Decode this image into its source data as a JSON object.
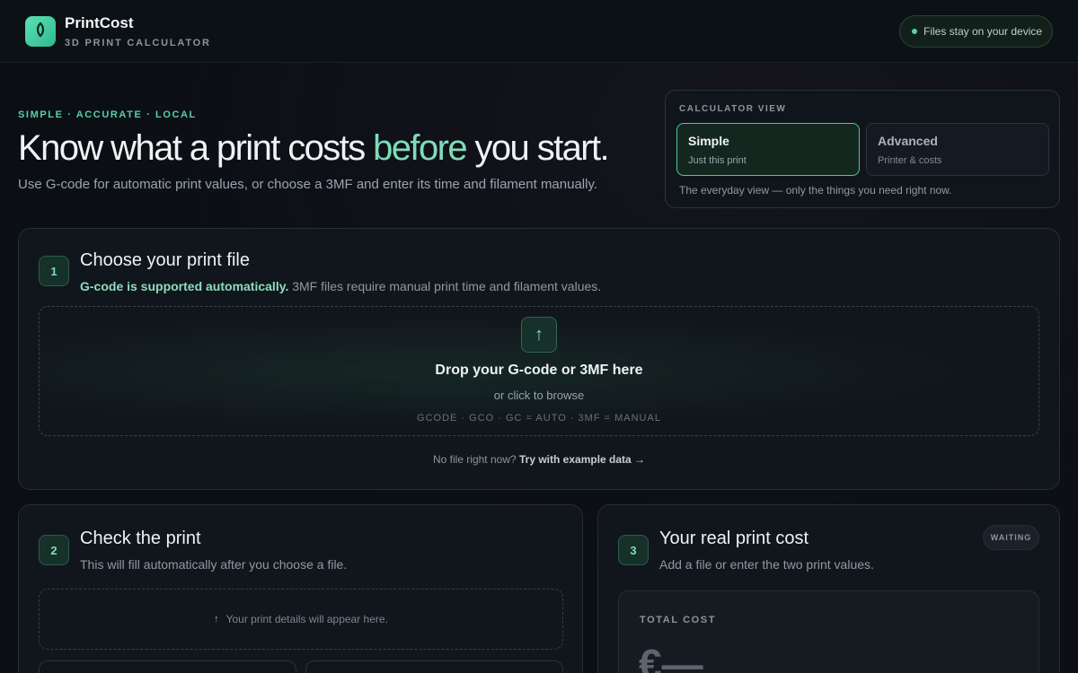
{
  "header": {
    "brand": "PrintCost",
    "subtitle": "3D PRINT CALCULATOR",
    "privacy_badge": "Files stay on your device",
    "logo_icon": "leaf-drop-icon"
  },
  "hero": {
    "eyebrow": "SIMPLE · ACCURATE · LOCAL",
    "headline_pre": "Know what a print costs ",
    "headline_accent": "before",
    "headline_post": " you start.",
    "lede": "Use G-code for automatic print values, or choose a 3MF and enter its time and filament manually."
  },
  "view_panel": {
    "caption": "CALCULATOR VIEW",
    "options": [
      {
        "title": "Simple",
        "subtitle": "Just this print",
        "active": true
      },
      {
        "title": "Advanced",
        "subtitle": "Printer & costs",
        "active": false
      }
    ],
    "note": "The everyday view — only the things you need right now."
  },
  "step1": {
    "number": "1",
    "title": "Choose your print file",
    "subtitle_strong": "G-code is supported automatically.",
    "subtitle_rest": " 3MF files require manual print time and filament values.",
    "drop_icon": "upload-arrow-icon",
    "drop_title": "Drop your G-code or 3MF here",
    "drop_sub": "or click to browse",
    "drop_formats": "GCODE · GCO · GC = AUTO  ·  3MF = MANUAL",
    "example_pre": "No file right now? ",
    "example_link": "Try with example data →"
  },
  "step2": {
    "number": "2",
    "title": "Check the print",
    "subtitle": "This will fill automatically after you choose a file.",
    "placeholder_icon": "↑",
    "placeholder": "Your print details will appear here."
  },
  "step3": {
    "number": "3",
    "title": "Your real print cost",
    "subtitle": "Add a file or enter the two print values.",
    "status": "WAITING",
    "total_caption": "TOTAL COST",
    "total_value": "€—"
  },
  "colors": {
    "accent": "#55d1a5",
    "background": "#0b0f14",
    "card": "#11161c"
  }
}
